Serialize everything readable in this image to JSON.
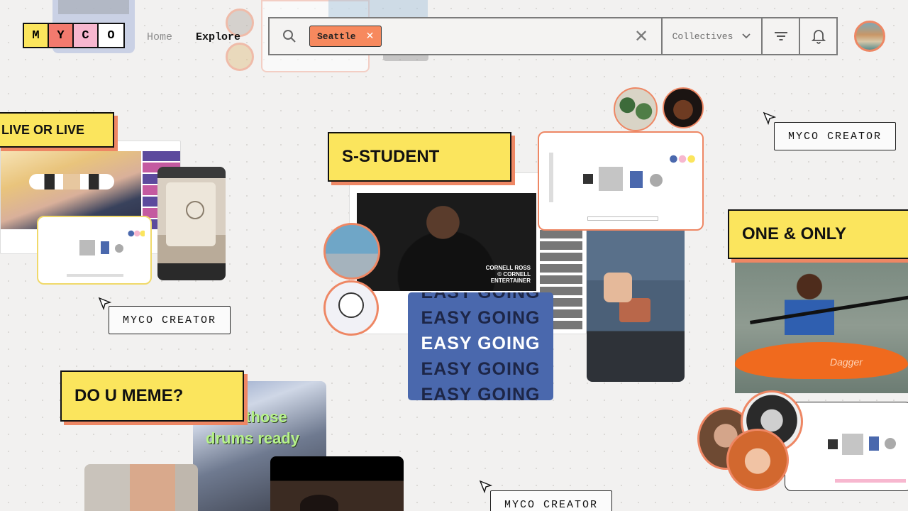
{
  "header": {
    "logo_letters": [
      "M",
      "Y",
      "C",
      "O"
    ],
    "logo_colors": [
      "#fbe55d",
      "#f37a6e",
      "#f7b7cf",
      "#ffffff"
    ],
    "nav": {
      "home": "Home",
      "explore": "Explore"
    },
    "search": {
      "chip": "Seattle",
      "dropdown": "Collectives"
    }
  },
  "labels": {
    "live": "LIVE OR LIVE",
    "student": "S-STUDENT",
    "one_only": "ONE & ONLY",
    "meme": "DO U MEME?",
    "creator": "MYCO CREATOR"
  },
  "easy_going": [
    "EASY GOING",
    "EASY GOING",
    "EASY GOING",
    "EASY GOING",
    "EASY GOING"
  ],
  "video": {
    "caption_line1": "CORNELL ROSS",
    "caption_line2": "© CORNELL",
    "caption_line3": "ENTERTAINER"
  },
  "meme_card": {
    "line1": "those",
    "line2": "drums ready"
  },
  "kayak": {
    "brand": "Dagger"
  },
  "colors": {
    "accent": "#ee8764",
    "yellow": "#fbe55d",
    "blue": "#4a68ad"
  }
}
